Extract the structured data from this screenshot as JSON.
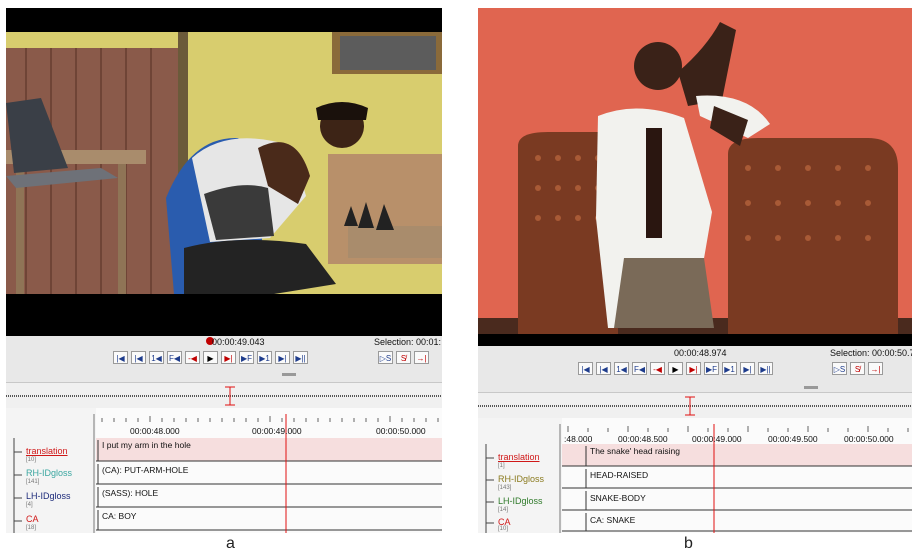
{
  "panel_a": {
    "player": {
      "time": "00:00:49.043",
      "selection": "Selection: 00:01:"
    },
    "ruler": [
      "00:00:48.000",
      "00:00:49.000",
      "00:00:50.000"
    ],
    "tiers": [
      {
        "name": "translation",
        "count": "[10]",
        "value": "I put my arm in the hole",
        "color": "#d01818"
      },
      {
        "name": "RH-IDgloss",
        "count": "[141]",
        "value": "(CA): PUT-ARM-HOLE",
        "color": "#3aa6a0"
      },
      {
        "name": "LH-IDgloss",
        "count": "[4]",
        "value": "(SASS): HOLE",
        "color": "#1c2a7a"
      },
      {
        "name": "CA",
        "count": "[18]",
        "value": "CA: BOY",
        "color": "#d01818"
      }
    ],
    "caption": "a"
  },
  "panel_b": {
    "player": {
      "time": "00:00:48.974",
      "selection": "Selection: 00:00:50.7"
    },
    "ruler": [
      ":48.000",
      "00:00:48.500",
      "00:00:49.000",
      "00:00:49.500",
      "00:00:50.000"
    ],
    "tiers": [
      {
        "name": "translation",
        "count": "[1]",
        "value": "The snake' head raising",
        "color": "#d01818"
      },
      {
        "name": "RH-IDgloss",
        "count": "[143]",
        "value": "HEAD-RAISED",
        "color": "#8a7a1e"
      },
      {
        "name": "LH-IDgloss",
        "count": "[14]",
        "value": "SNAKE-BODY",
        "color": "#2f7a2a"
      },
      {
        "name": "CA",
        "count": "[10]",
        "value": "CA: SNAKE",
        "color": "#d01818"
      }
    ],
    "caption": "b"
  },
  "colors": {
    "cursor": "#e01010",
    "accent": "#1e3c8c"
  }
}
